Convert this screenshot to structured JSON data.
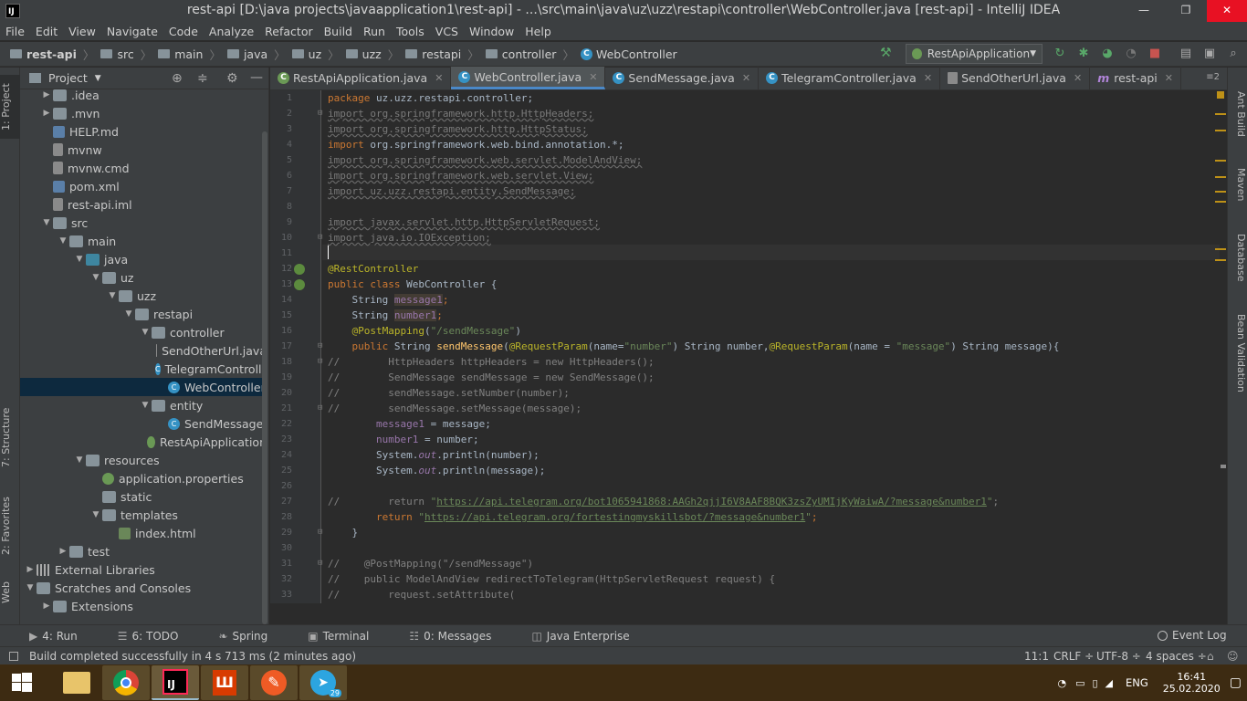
{
  "window": {
    "title": "rest-api [D:\\java projects\\javaapplication1\\rest-api] - ...\\src\\main\\java\\uz\\uzz\\restapi\\controller\\WebController.java [rest-api] - IntelliJ IDEA",
    "logo": "IJ",
    "minimize": "—",
    "maximize": "❐",
    "close": "✕"
  },
  "menu": [
    "File",
    "Edit",
    "View",
    "Navigate",
    "Code",
    "Analyze",
    "Refactor",
    "Build",
    "Run",
    "Tools",
    "VCS",
    "Window",
    "Help"
  ],
  "breadcrumbs": [
    "rest-api",
    "src",
    "main",
    "java",
    "uz",
    "uzz",
    "restapi",
    "controller",
    "WebController"
  ],
  "run_config": "RestApiApplication",
  "project_panel": {
    "title": "Project"
  },
  "tree": [
    {
      "label": ".idea",
      "depth": 1,
      "arrow": "▶",
      "icon": "folder"
    },
    {
      "label": ".mvn",
      "depth": 1,
      "arrow": "▶",
      "icon": "folder"
    },
    {
      "label": "HELP.md",
      "depth": 1,
      "arrow": "",
      "icon": "md"
    },
    {
      "label": "mvnw",
      "depth": 1,
      "arrow": "",
      "icon": "file"
    },
    {
      "label": "mvnw.cmd",
      "depth": 1,
      "arrow": "",
      "icon": "file"
    },
    {
      "label": "pom.xml",
      "depth": 1,
      "arrow": "",
      "icon": "md"
    },
    {
      "label": "rest-api.iml",
      "depth": 1,
      "arrow": "",
      "icon": "file"
    },
    {
      "label": "src",
      "depth": 1,
      "arrow": "▼",
      "icon": "folder"
    },
    {
      "label": "main",
      "depth": 2,
      "arrow": "▼",
      "icon": "folder"
    },
    {
      "label": "java",
      "depth": 3,
      "arrow": "▼",
      "icon": "srcfolder"
    },
    {
      "label": "uz",
      "depth": 4,
      "arrow": "▼",
      "icon": "folder"
    },
    {
      "label": "uzz",
      "depth": 5,
      "arrow": "▼",
      "icon": "folder"
    },
    {
      "label": "restapi",
      "depth": 6,
      "arrow": "▼",
      "icon": "folder"
    },
    {
      "label": "controller",
      "depth": 7,
      "arrow": "▼",
      "icon": "folder"
    },
    {
      "label": "SendOtherUrl.java",
      "depth": 8,
      "arrow": "",
      "icon": "file"
    },
    {
      "label": "TelegramController",
      "depth": 8,
      "arrow": "",
      "icon": "class"
    },
    {
      "label": "WebController",
      "depth": 8,
      "arrow": "",
      "icon": "class",
      "selected": true
    },
    {
      "label": "entity",
      "depth": 7,
      "arrow": "▼",
      "icon": "folder"
    },
    {
      "label": "SendMessage",
      "depth": 8,
      "arrow": "",
      "icon": "class"
    },
    {
      "label": "RestApiApplication",
      "depth": 7,
      "arrow": "",
      "icon": "spring"
    },
    {
      "label": "resources",
      "depth": 3,
      "arrow": "▼",
      "icon": "folder"
    },
    {
      "label": "application.properties",
      "depth": 4,
      "arrow": "",
      "icon": "spring"
    },
    {
      "label": "static",
      "depth": 4,
      "arrow": "",
      "icon": "folder"
    },
    {
      "label": "templates",
      "depth": 4,
      "arrow": "▼",
      "icon": "folder"
    },
    {
      "label": "index.html",
      "depth": 5,
      "arrow": "",
      "icon": "html"
    },
    {
      "label": "test",
      "depth": 2,
      "arrow": "▶",
      "icon": "folder"
    },
    {
      "label": "External Libraries",
      "depth": 0,
      "arrow": "▶",
      "icon": "lib"
    },
    {
      "label": "Scratches and Consoles",
      "depth": 0,
      "arrow": "▼",
      "icon": "scratch"
    },
    {
      "label": "Extensions",
      "depth": 1,
      "arrow": "▶",
      "icon": "folder"
    }
  ],
  "tabs": [
    {
      "label": "RestApiApplication.java",
      "icon": "spring"
    },
    {
      "label": "WebController.java",
      "icon": "class",
      "active": true
    },
    {
      "label": "SendMessage.java",
      "icon": "class"
    },
    {
      "label": "TelegramController.java",
      "icon": "class"
    },
    {
      "label": "SendOtherUrl.java",
      "icon": "file"
    },
    {
      "label": "rest-api",
      "icon": "maven"
    }
  ],
  "tab_count": "≡2",
  "code": [
    [
      {
        "c": "k",
        "t": "package "
      },
      {
        "t": "uz.uzz.restapi.controller;"
      }
    ],
    [
      {
        "c": "unused",
        "t": "import org.springframework.http.HttpHeaders;"
      }
    ],
    [
      {
        "c": "unused",
        "t": "import org.springframework.http.HttpStatus;"
      }
    ],
    [
      {
        "c": "k",
        "t": "import "
      },
      {
        "t": "org.springframework.web.bind.annotation.*;"
      }
    ],
    [
      {
        "c": "unused",
        "t": "import org.springframework.web.servlet.ModelAndView;"
      }
    ],
    [
      {
        "c": "unused",
        "t": "import org.springframework.web.servlet.View;"
      }
    ],
    [
      {
        "c": "unused",
        "t": "import uz.uzz.restapi.entity.SendMessage;"
      }
    ],
    [],
    [
      {
        "c": "unused",
        "t": "import javax.servlet.http.HttpServletRequest;"
      }
    ],
    [
      {
        "c": "unused",
        "t": "import java.io.IOException;"
      }
    ],
    [],
    [
      {
        "c": "a",
        "t": "@RestController"
      }
    ],
    [
      {
        "c": "k",
        "t": "public class "
      },
      {
        "t": "WebController {"
      }
    ],
    [
      {
        "t": "    String "
      },
      {
        "c": "f hl",
        "t": "message1"
      },
      {
        "c": "k",
        "t": ";"
      }
    ],
    [
      {
        "t": "    String "
      },
      {
        "c": "f hl",
        "t": "number1"
      },
      {
        "c": "k",
        "t": ";"
      }
    ],
    [
      {
        "c": "a",
        "t": "    @PostMapping"
      },
      {
        "t": "("
      },
      {
        "c": "s",
        "t": "\"/sendMessage\""
      },
      {
        "t": ")"
      }
    ],
    [
      {
        "c": "k",
        "t": "    public "
      },
      {
        "t": "String "
      },
      {
        "c": "fn",
        "t": "sendMessage"
      },
      {
        "t": "("
      },
      {
        "c": "a",
        "t": "@RequestParam"
      },
      {
        "t": "(name="
      },
      {
        "c": "s",
        "t": "\"number\""
      },
      {
        "t": ") String number,"
      },
      {
        "c": "a",
        "t": "@RequestParam"
      },
      {
        "t": "(name = "
      },
      {
        "c": "s",
        "t": "\"message\""
      },
      {
        "t": ") String message){"
      }
    ],
    [
      {
        "c": "cm",
        "t": "//        HttpHeaders httpHeaders = new HttpHeaders();"
      }
    ],
    [
      {
        "c": "cm",
        "t": "//        SendMessage sendMessage = new SendMessage();"
      }
    ],
    [
      {
        "c": "cm",
        "t": "//        sendMessage.setNumber(number);"
      }
    ],
    [
      {
        "c": "cm",
        "t": "//        sendMessage.setMessage(message);"
      }
    ],
    [
      {
        "c": "f",
        "t": "        message1"
      },
      {
        "t": " = message;"
      }
    ],
    [
      {
        "c": "f",
        "t": "        number1"
      },
      {
        "t": " = number;"
      }
    ],
    [
      {
        "t": "        System."
      },
      {
        "c": "f it",
        "t": "out"
      },
      {
        "t": ".println(number);"
      }
    ],
    [
      {
        "t": "        System."
      },
      {
        "c": "f it",
        "t": "out"
      },
      {
        "t": ".println(message);"
      }
    ],
    [],
    [
      {
        "c": "cm",
        "t": "//        return "
      },
      {
        "c": "s",
        "t": "\""
      },
      {
        "c": "s u",
        "t": "https://api.telegram.org/bot1065941868:AAGh2qjjI6V8AAF8BQK3zsZyUMIjKyWaiwA/?message&number1"
      },
      {
        "c": "s",
        "t": "\""
      },
      {
        "c": "cm",
        "t": ";"
      }
    ],
    [
      {
        "c": "k",
        "t": "        return "
      },
      {
        "c": "s",
        "t": "\""
      },
      {
        "c": "s u",
        "t": "https://api.telegram.org/fortestingmyskillsbot/?message&number1"
      },
      {
        "c": "s",
        "t": "\""
      },
      {
        "c": "k",
        "t": ";"
      }
    ],
    [
      {
        "t": "    }"
      }
    ],
    [],
    [
      {
        "c": "cm",
        "t": "//    @PostMapping(\"/sendMessage\")"
      }
    ],
    [
      {
        "c": "cm",
        "t": "//    public ModelAndView redirectToTelegram(HttpServletRequest request) {"
      }
    ],
    [
      {
        "c": "cm",
        "t": "//        request.setAttribute("
      }
    ]
  ],
  "left_tabs": [
    "1: Project",
    "7: Structure",
    "2: Favorites",
    "Web"
  ],
  "right_tabs": [
    "Ant Build",
    "Maven",
    "Database",
    "Bean Validation"
  ],
  "bottom_tabs": [
    "4: Run",
    "6: TODO",
    "Spring",
    "Terminal",
    "0: Messages",
    "Java Enterprise"
  ],
  "event_log": "Event Log",
  "status": {
    "message": "Build completed successfully in 4 s 713 ms (2 minutes ago)",
    "position": "11:1",
    "line_sep": "CRLF ÷",
    "encoding": "UTF-8 ÷",
    "indent": "4 spaces ÷"
  },
  "taskbar": {
    "lang": "ENG",
    "time": "16:41",
    "date": "25.02.2020",
    "telegram_badge": "29"
  },
  "colors": {
    "accent": "#4a88c7",
    "selection": "#0d293e",
    "close": "#e81123"
  }
}
